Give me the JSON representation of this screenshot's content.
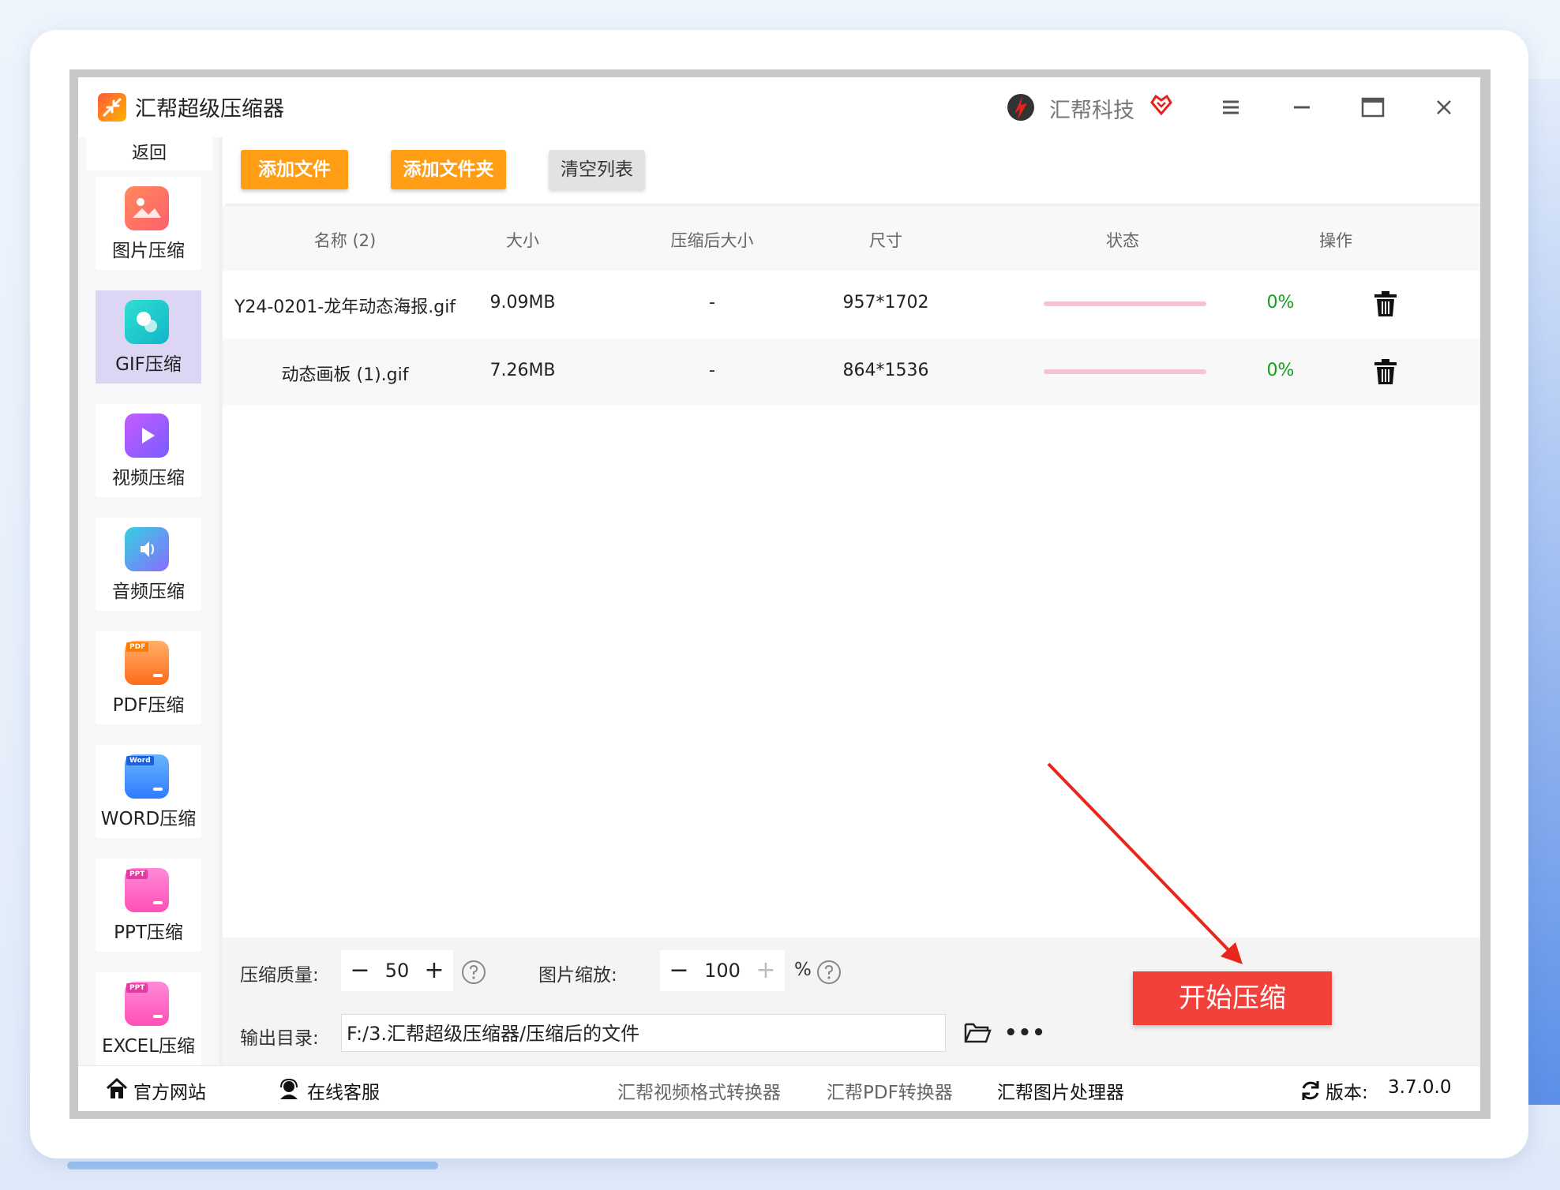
{
  "app": {
    "title": "汇帮超级压缩器",
    "brand": "汇帮科技",
    "colors": {
      "accent_orange": "#ff9d14",
      "start_red": "#f2413a",
      "active_nav": "#dcd5f3",
      "progress_pink": "#f7c3d2",
      "percent_green": "#11a01c"
    }
  },
  "sidebar": {
    "back_label": "返回",
    "items": [
      {
        "label": "图片压缩",
        "icon": "image-icon"
      },
      {
        "label": "GIF压缩",
        "icon": "gif-icon",
        "active": true
      },
      {
        "label": "视频压缩",
        "icon": "video-icon"
      },
      {
        "label": "音频压缩",
        "icon": "audio-icon"
      },
      {
        "label": "PDF压缩",
        "icon": "pdf-icon",
        "badge": "PDF"
      },
      {
        "label": "WORD压缩",
        "icon": "word-icon",
        "badge": "Word"
      },
      {
        "label": "PPT压缩",
        "icon": "ppt-icon",
        "badge": "PPT"
      },
      {
        "label": "EXCEL压缩",
        "icon": "excel-icon",
        "badge": "PPT"
      }
    ]
  },
  "toolbar": {
    "add_file": "添加文件",
    "add_folder": "添加文件夹",
    "clear_list": "清空列表"
  },
  "table": {
    "columns": [
      "名称 (2)",
      "大小",
      "压缩后大小",
      "尺寸",
      "状态",
      "操作"
    ],
    "rows": [
      {
        "name": "Y24-0201-龙年动态海报.gif",
        "size": "9.09MB",
        "compressed": "-",
        "dims": "957*1702",
        "progress": 0,
        "percent": "0%"
      },
      {
        "name": "动态画板 (1).gif",
        "size": "7.26MB",
        "compressed": "-",
        "dims": "864*1536",
        "progress": 0,
        "percent": "0%"
      }
    ]
  },
  "settings": {
    "quality_label": "压缩质量:",
    "quality_value": "50",
    "scale_label": "图片缩放:",
    "scale_value": "100",
    "scale_unit": "%",
    "output_label": "输出目录:",
    "output_path": "F:/3.汇帮超级压缩器/压缩后的文件",
    "start_button": "开始压缩"
  },
  "footer": {
    "website": "官方网站",
    "support": "在线客服",
    "link_video": "汇帮视频格式转换器",
    "link_pdf": "汇帮PDF转换器",
    "link_image": "汇帮图片处理器",
    "version_label": "版本:",
    "version": "3.7.0.0"
  }
}
